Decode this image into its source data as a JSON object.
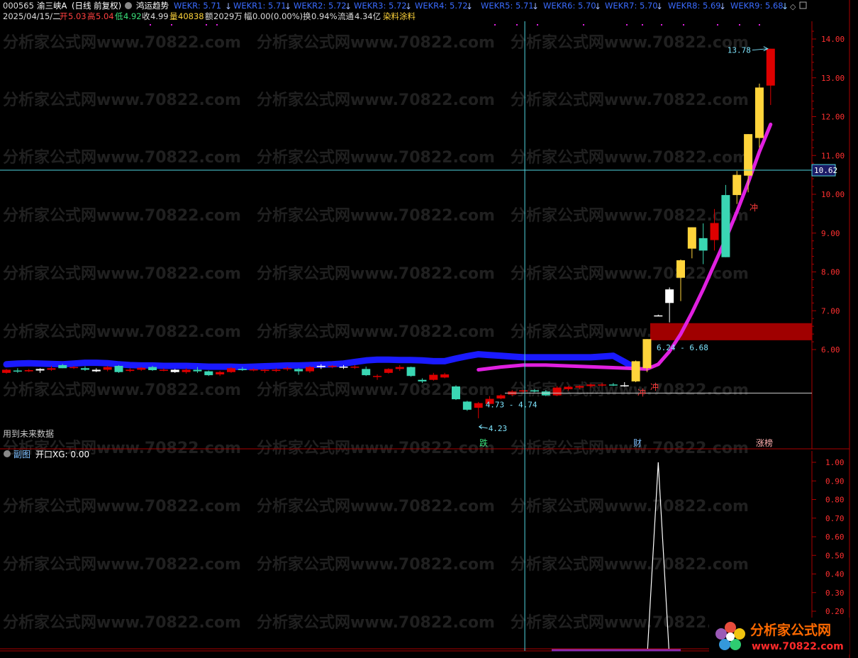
{
  "header": {
    "code": "000565",
    "name": "渝三峡A",
    "period": "(日线 前复权)",
    "indicator": "鸿运趋势",
    "wekr": [
      {
        "label": "WEKR",
        "value": "5.71"
      },
      {
        "label": "WEKR1",
        "value": "5.71"
      },
      {
        "label": "WEKR2",
        "value": "5.72"
      },
      {
        "label": "WEKR3",
        "value": "5.72"
      },
      {
        "label": "WEKR4",
        "value": "5.72"
      },
      {
        "label": "WEKR5",
        "value": "5.71"
      },
      {
        "label": "WEKR6",
        "value": "5.70"
      },
      {
        "label": "WEKR7",
        "value": "5.70"
      },
      {
        "label": "WEKR8",
        "value": "5.69"
      },
      {
        "label": "WEKR9",
        "value": "5.68"
      }
    ],
    "date": "2025/04/15/二",
    "open_label": "开",
    "open": "5.03",
    "high_label": "高",
    "high": "5.04",
    "low_label": "低",
    "low": "4.92",
    "close_label": "收",
    "close": "4.99",
    "vol_label": "量",
    "vol": "40838",
    "amount_label": "额",
    "amount": "2029万",
    "change_label": "幅",
    "change": "0.00(0.00%)",
    "turnover_label": "换",
    "turnover": "0.94%",
    "float_label": "流通",
    "float": "4.34亿",
    "sector": "染料涂料"
  },
  "main_panel": {
    "future_note": "用到未来数据",
    "crosshair_price": "10.62",
    "annotations": {
      "high_label": "13.78",
      "low_label": "4.23",
      "low_range": "4.73 - 4.74",
      "breakout_range": "6.24 - 6.68",
      "chong": "冲",
      "die": "跌",
      "cai": "财",
      "zhangbang": "涨榜"
    },
    "colors": {
      "up": "#dd0000",
      "down": "#3ad6b3",
      "strong_up": "#ffd43b",
      "trend_band": "#1a1aff",
      "trend_line": "#e020e0",
      "grid_axis": "#aa0000",
      "resistance_zone": "#a00000"
    }
  },
  "sub_panel": {
    "title": "副图",
    "series_label": "开口XG: 0.00"
  },
  "watermark": {
    "text": "分析家公式网www.70822.com",
    "logo_title": "分析家公式网",
    "logo_url": "www.70822.com"
  },
  "chart_data": [
    {
      "type": "candlestick",
      "title": "",
      "ylim": [
        4.0,
        14.4
      ],
      "yticks": [
        6.0,
        7.0,
        8.0,
        9.0,
        10.0,
        11.0,
        12.0,
        13.0,
        14.0
      ],
      "candles": [
        [
          5.4,
          5.5,
          5.38,
          5.48
        ],
        [
          5.46,
          5.52,
          5.4,
          5.44
        ],
        [
          5.44,
          5.5,
          5.42,
          5.47
        ],
        [
          5.46,
          5.52,
          5.4,
          5.5
        ],
        [
          5.48,
          5.58,
          5.45,
          5.52
        ],
        [
          5.6,
          5.63,
          5.52,
          5.52
        ],
        [
          5.55,
          5.58,
          5.5,
          5.55
        ],
        [
          5.52,
          5.57,
          5.45,
          5.48
        ],
        [
          5.48,
          5.52,
          5.42,
          5.44
        ],
        [
          5.48,
          5.58,
          5.44,
          5.55
        ],
        [
          5.58,
          5.6,
          5.4,
          5.42
        ],
        [
          5.45,
          5.52,
          5.42,
          5.48
        ],
        [
          5.48,
          5.55,
          5.45,
          5.53
        ],
        [
          5.55,
          5.58,
          5.45,
          5.47
        ],
        [
          5.48,
          5.52,
          5.44,
          5.48
        ],
        [
          5.48,
          5.5,
          5.4,
          5.42
        ],
        [
          5.42,
          5.52,
          5.38,
          5.48
        ],
        [
          5.48,
          5.55,
          5.4,
          5.44
        ],
        [
          5.44,
          5.46,
          5.32,
          5.34
        ],
        [
          5.36,
          5.45,
          5.32,
          5.42
        ],
        [
          5.42,
          5.55,
          5.4,
          5.52
        ],
        [
          5.5,
          5.55,
          5.45,
          5.47
        ],
        [
          5.47,
          5.52,
          5.44,
          5.49
        ],
        [
          5.45,
          5.5,
          5.4,
          5.48
        ],
        [
          5.45,
          5.52,
          5.42,
          5.48
        ],
        [
          5.52,
          5.56,
          5.45,
          5.52
        ],
        [
          5.5,
          5.52,
          5.35,
          5.44
        ],
        [
          5.44,
          5.58,
          5.4,
          5.55
        ],
        [
          5.55,
          5.62,
          5.5,
          5.58
        ],
        [
          5.56,
          5.6,
          5.52,
          5.58
        ],
        [
          5.56,
          5.6,
          5.5,
          5.55
        ],
        [
          5.56,
          5.6,
          5.5,
          5.56
        ],
        [
          5.5,
          5.56,
          5.32,
          5.34
        ],
        [
          5.3,
          5.36,
          5.22,
          5.32
        ],
        [
          5.4,
          5.52,
          5.38,
          5.5
        ],
        [
          5.5,
          5.6,
          5.45,
          5.55
        ],
        [
          5.55,
          5.56,
          5.3,
          5.32
        ],
        [
          5.22,
          5.26,
          5.14,
          5.18
        ],
        [
          5.22,
          5.4,
          5.2,
          5.35
        ],
        [
          5.28,
          5.4,
          5.26,
          5.36
        ],
        [
          5.05,
          5.08,
          4.7,
          4.72
        ],
        [
          4.66,
          4.68,
          4.42,
          4.45
        ],
        [
          4.5,
          4.65,
          4.23,
          4.62
        ],
        [
          4.6,
          4.8,
          4.58,
          4.73
        ],
        [
          4.74,
          4.85,
          4.72,
          4.82
        ],
        [
          4.84,
          4.96,
          4.8,
          4.92
        ],
        [
          4.92,
          4.96,
          4.88,
          4.95
        ],
        [
          4.95,
          4.98,
          4.9,
          4.92
        ],
        [
          4.92,
          4.96,
          4.8,
          4.82
        ],
        [
          4.82,
          5.06,
          4.8,
          5.02
        ],
        [
          4.98,
          5.06,
          4.94,
          5.04
        ],
        [
          5.02,
          5.08,
          4.98,
          5.06
        ],
        [
          5.06,
          5.12,
          5.02,
          5.1
        ],
        [
          5.1,
          5.14,
          5.05,
          5.1
        ],
        [
          5.1,
          5.14,
          5.06,
          5.08
        ],
        [
          5.08,
          5.16,
          5.04,
          5.08
        ],
        [
          5.18,
          5.72,
          5.16,
          5.7
        ],
        [
          5.52,
          6.27,
          5.42,
          6.27
        ],
        [
          6.88,
          6.9,
          6.86,
          6.88
        ],
        [
          7.2,
          7.6,
          6.7,
          7.55
        ],
        [
          7.85,
          8.32,
          7.25,
          8.3
        ],
        [
          8.6,
          9.15,
          8.35,
          9.15
        ],
        [
          8.87,
          9.25,
          8.2,
          8.55
        ],
        [
          8.82,
          9.62,
          8.55,
          9.26
        ],
        [
          9.98,
          10.24,
          8.38,
          8.38
        ],
        [
          10.5,
          10.6,
          9.75,
          9.98
        ],
        [
          10.48,
          11.55,
          10.05,
          11.55
        ],
        [
          11.45,
          12.85,
          11.2,
          12.75
        ],
        [
          12.8,
          13.75,
          12.3,
          13.75
        ]
      ],
      "strong_up_index": [
        56,
        57,
        60,
        61,
        65,
        66,
        67
      ],
      "cross_index": [
        3,
        8,
        15,
        28,
        30,
        55,
        58,
        59
      ],
      "trend_band": [
        5.62,
        5.64,
        5.65,
        5.64,
        5.63,
        5.62,
        5.64,
        5.66,
        5.66,
        5.65,
        5.62,
        5.6,
        5.59,
        5.59,
        5.58,
        5.58,
        5.58,
        5.57,
        5.56,
        5.56,
        5.56,
        5.55,
        5.56,
        5.57,
        5.58,
        5.59,
        5.59,
        5.6,
        5.61,
        5.62,
        5.64,
        5.68,
        5.72,
        5.74,
        5.74,
        5.73,
        5.73,
        5.72,
        5.7,
        5.7,
        5.77,
        5.83,
        5.88,
        5.86,
        5.84,
        5.82,
        5.8,
        5.8,
        5.8,
        5.8,
        5.8,
        5.8,
        5.8,
        5.82,
        5.84,
        5.68,
        5.52
      ],
      "trend_line": [
        [
          42,
          5.48
        ],
        [
          44,
          5.55
        ],
        [
          46,
          5.6
        ],
        [
          48,
          5.6
        ],
        [
          57,
          5.5
        ],
        [
          58,
          5.62
        ],
        [
          59,
          5.95
        ],
        [
          60,
          6.4
        ],
        [
          61,
          6.95
        ],
        [
          62,
          7.55
        ],
        [
          63,
          8.2
        ],
        [
          64,
          8.85
        ],
        [
          65,
          9.55
        ],
        [
          66,
          10.3
        ],
        [
          67,
          11.1
        ],
        [
          68,
          11.8
        ]
      ],
      "resistance_zone": [
        6.24,
        6.68
      ],
      "crosshair_index": 46,
      "crosshair_price": 10.62,
      "reference_price": 4.88
    },
    {
      "type": "line",
      "title": "",
      "series": [
        {
          "name": "开口XG",
          "spike_index": 58,
          "spike_value": 1.0
        }
      ],
      "ylim": [
        0.1,
        1.04
      ],
      "yticks": [
        1.0,
        0.9,
        0.8,
        0.7,
        0.6,
        0.5,
        0.4,
        0.3,
        0.2
      ]
    }
  ]
}
